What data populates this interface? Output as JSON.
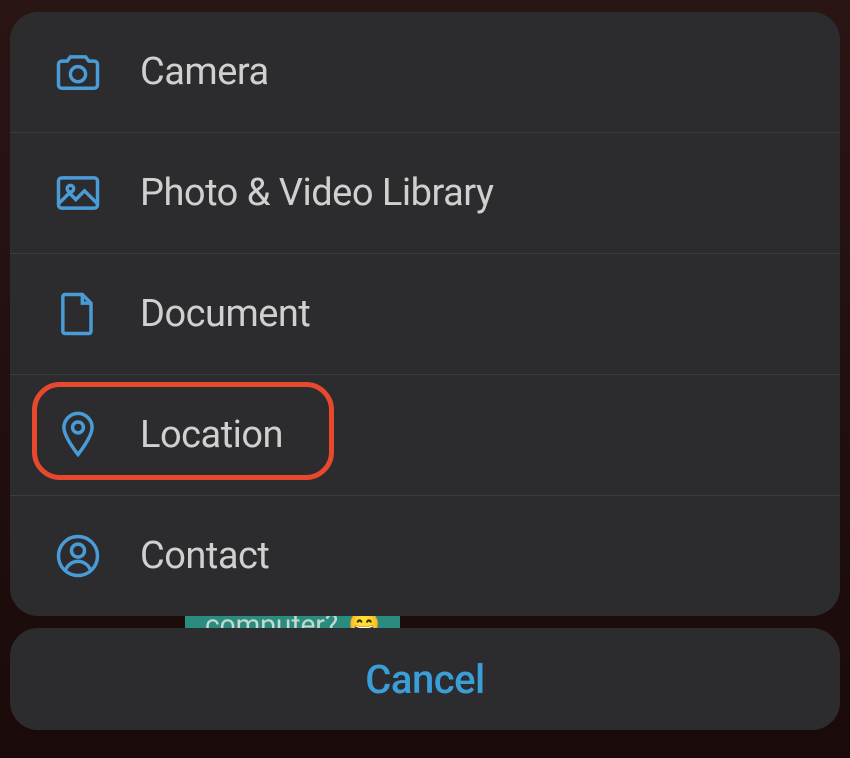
{
  "menu": {
    "items": [
      {
        "icon": "camera-icon",
        "label": "Camera"
      },
      {
        "icon": "photo-icon",
        "label": "Photo & Video Library"
      },
      {
        "icon": "document-icon",
        "label": "Document"
      },
      {
        "icon": "location-icon",
        "label": "Location",
        "highlighted": true
      },
      {
        "icon": "contact-icon",
        "label": "Contact"
      }
    ]
  },
  "cancel": {
    "label": "Cancel"
  },
  "background": {
    "chat_text": "computer?",
    "emoji": "😄"
  },
  "colors": {
    "icon": "#4a9cd8",
    "text": "#d0d0d0",
    "cancel_text": "#3a9ed8",
    "sheet_bg": "#2c2c2e",
    "highlight": "#e8492e"
  }
}
